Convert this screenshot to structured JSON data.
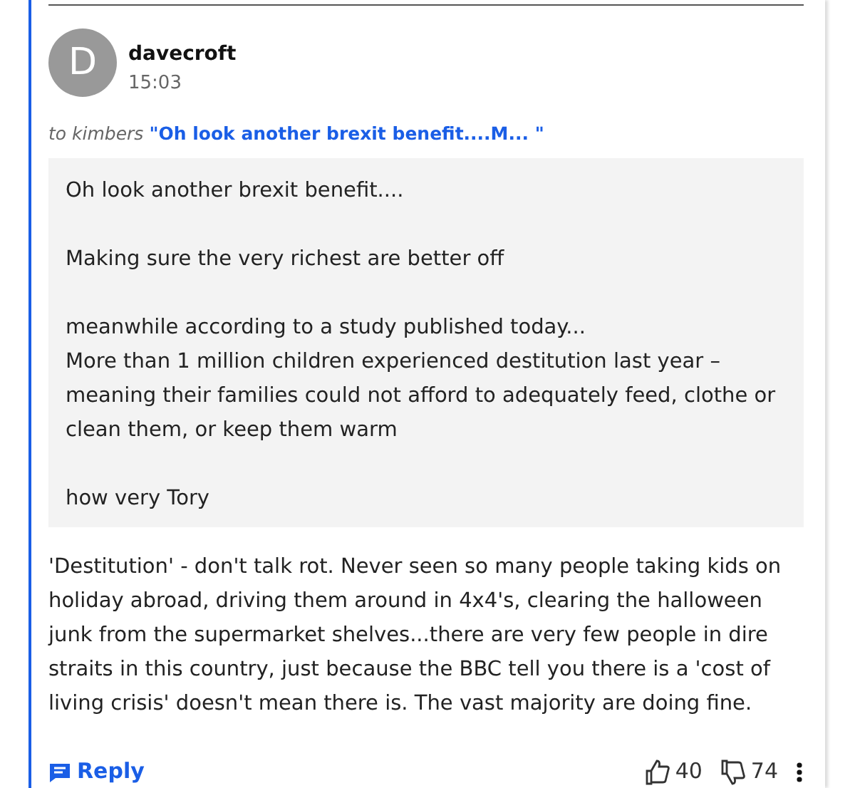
{
  "comment": {
    "avatar_letter": "D",
    "author": "davecroft",
    "time": "15:03",
    "reply_to": {
      "prefix": "to kimbers",
      "quote_link": "\"Oh look another brexit benefit....M... \""
    },
    "quote": [
      [
        "Oh look another brexit benefit...."
      ],
      [
        "Making sure the very richest are better off"
      ],
      [
        "meanwhile according to a study published today...",
        "More than 1 million children experienced destitution last year – meaning their families could not afford to adequately feed, clothe or clean them, or keep them warm"
      ],
      [
        "how very Tory"
      ]
    ],
    "body": "'Destitution' - don't talk rot. Never seen so many people taking kids on holiday abroad, driving them around in 4x4's, clearing the halloween junk from the supermarket shelves...there are very few people in dire straits in this country, just because the BBC tell you there is a 'cost of living crisis' doesn't mean there is. The vast majority are doing fine.",
    "reply_label": "Reply",
    "likes": "40",
    "dislikes": "74"
  }
}
